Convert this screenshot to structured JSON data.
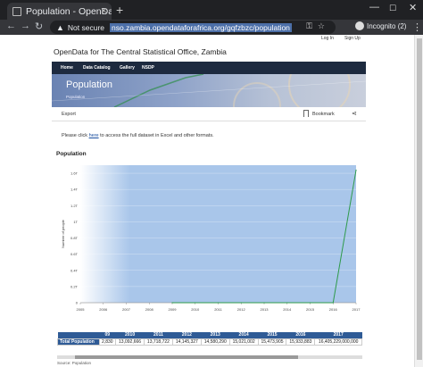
{
  "browser": {
    "tab_title": "Population - OpenData",
    "tab_close_glyph": "✕",
    "new_tab_glyph": "+",
    "security_label": "Not secure",
    "url": "nso.zambia.opendataforafrica.org/gqfzbzc/population",
    "profile_label": "Incognito (2)"
  },
  "page": {
    "login": "Log In",
    "signup": "Sign Up",
    "site_title": "OpenData for The Central Statistical Office, Zambia",
    "nav": [
      "Home",
      "Data Catalog",
      "Gallery",
      "NSDP"
    ],
    "hero_title": "Population",
    "hero_crumb": "Population",
    "export": "Export",
    "bookmark": "Bookmark",
    "notice_pre": "Please click ",
    "notice_link": "here",
    "notice_post": " to access the full dataset in Excel and other formats.",
    "chart_heading": "Population",
    "source": "Source: Population"
  },
  "chart_data": {
    "type": "line",
    "title": "Population",
    "xlabel": "",
    "ylabel": "Number of people",
    "x": [
      2005,
      2006,
      2007,
      2008,
      2009,
      2010,
      2011,
      2012,
      2013,
      2014,
      2015,
      2016,
      2017
    ],
    "ytick_labels": [
      "1.6T",
      "1.4T",
      "1.2T",
      "1T",
      "0.8T",
      "0.6T",
      "0.4T",
      "0.2T",
      "0"
    ],
    "ylim": [
      0,
      1.7
    ],
    "series": [
      {
        "values": [
          null,
          null,
          null,
          null,
          1.29e-05,
          1.31e-05,
          1.37e-05,
          1.41e-05,
          1.46e-05,
          1.5e-05,
          1.55e-05,
          1.59e-05,
          1.64
        ]
      }
    ],
    "line_color": "#2e9a4a",
    "area_color": "#a9c6ea"
  },
  "table": {
    "headers": [
      "",
      "09",
      "2010",
      "2011",
      "2012",
      "2013",
      "2014",
      "2015",
      "2016",
      "2017"
    ],
    "row_label": "Total Population",
    "values": [
      "2,830",
      "13,092,666",
      "13,718,722",
      "14,145,327",
      "14,580,290",
      "15,021,002",
      "15,473,905",
      "15,933,883",
      "16,405,229,000,000"
    ]
  },
  "colors": {
    "navbar": "#1d2a3f",
    "table_header": "#2f5b96",
    "link": "#1a4fa0"
  }
}
